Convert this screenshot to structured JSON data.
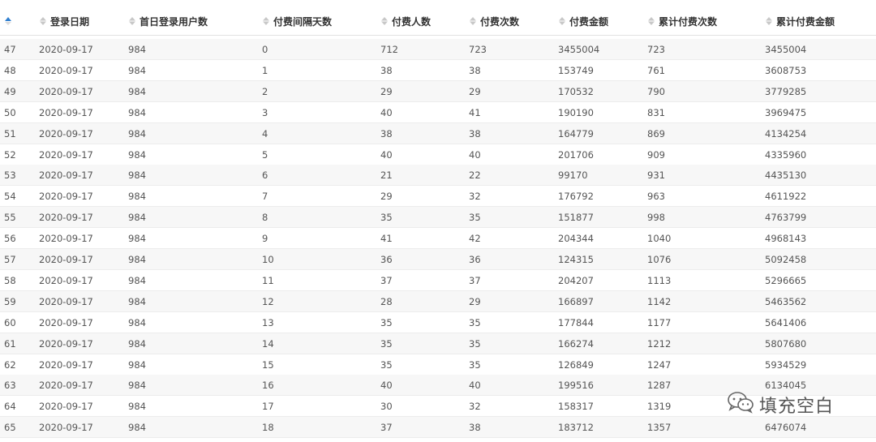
{
  "columns": [
    "",
    "登录日期",
    "首日登录用户数",
    "付费间隔天数",
    "付费人数",
    "付费次数",
    "付费金额",
    "累计付费次数",
    "累计付费金额"
  ],
  "rows": [
    [
      "47",
      "2020-09-17",
      "984",
      "0",
      "712",
      "723",
      "3455004",
      "723",
      "3455004"
    ],
    [
      "48",
      "2020-09-17",
      "984",
      "1",
      "38",
      "38",
      "153749",
      "761",
      "3608753"
    ],
    [
      "49",
      "2020-09-17",
      "984",
      "2",
      "29",
      "29",
      "170532",
      "790",
      "3779285"
    ],
    [
      "50",
      "2020-09-17",
      "984",
      "3",
      "40",
      "41",
      "190190",
      "831",
      "3969475"
    ],
    [
      "51",
      "2020-09-17",
      "984",
      "4",
      "38",
      "38",
      "164779",
      "869",
      "4134254"
    ],
    [
      "52",
      "2020-09-17",
      "984",
      "5",
      "40",
      "40",
      "201706",
      "909",
      "4335960"
    ],
    [
      "53",
      "2020-09-17",
      "984",
      "6",
      "21",
      "22",
      "99170",
      "931",
      "4435130"
    ],
    [
      "54",
      "2020-09-17",
      "984",
      "7",
      "29",
      "32",
      "176792",
      "963",
      "4611922"
    ],
    [
      "55",
      "2020-09-17",
      "984",
      "8",
      "35",
      "35",
      "151877",
      "998",
      "4763799"
    ],
    [
      "56",
      "2020-09-17",
      "984",
      "9",
      "41",
      "42",
      "204344",
      "1040",
      "4968143"
    ],
    [
      "57",
      "2020-09-17",
      "984",
      "10",
      "36",
      "36",
      "124315",
      "1076",
      "5092458"
    ],
    [
      "58",
      "2020-09-17",
      "984",
      "11",
      "37",
      "37",
      "204207",
      "1113",
      "5296665"
    ],
    [
      "59",
      "2020-09-17",
      "984",
      "12",
      "28",
      "29",
      "166897",
      "1142",
      "5463562"
    ],
    [
      "60",
      "2020-09-17",
      "984",
      "13",
      "35",
      "35",
      "177844",
      "1177",
      "5641406"
    ],
    [
      "61",
      "2020-09-17",
      "984",
      "14",
      "35",
      "35",
      "166274",
      "1212",
      "5807680"
    ],
    [
      "62",
      "2020-09-17",
      "984",
      "15",
      "35",
      "35",
      "126849",
      "1247",
      "5934529"
    ],
    [
      "63",
      "2020-09-17",
      "984",
      "16",
      "40",
      "40",
      "199516",
      "1287",
      "6134045"
    ],
    [
      "64",
      "2020-09-17",
      "984",
      "17",
      "30",
      "32",
      "158317",
      "1319",
      ""
    ],
    [
      "65",
      "2020-09-17",
      "984",
      "18",
      "37",
      "38",
      "183712",
      "1357",
      "6476074"
    ]
  ],
  "watermark": {
    "text": "填充空白",
    "icon": "wechat-icon"
  },
  "colors": {
    "sort_active": "#2f7fd0",
    "sort_inactive": "#c8c8c8",
    "row_alt": "#f7f7f7"
  }
}
